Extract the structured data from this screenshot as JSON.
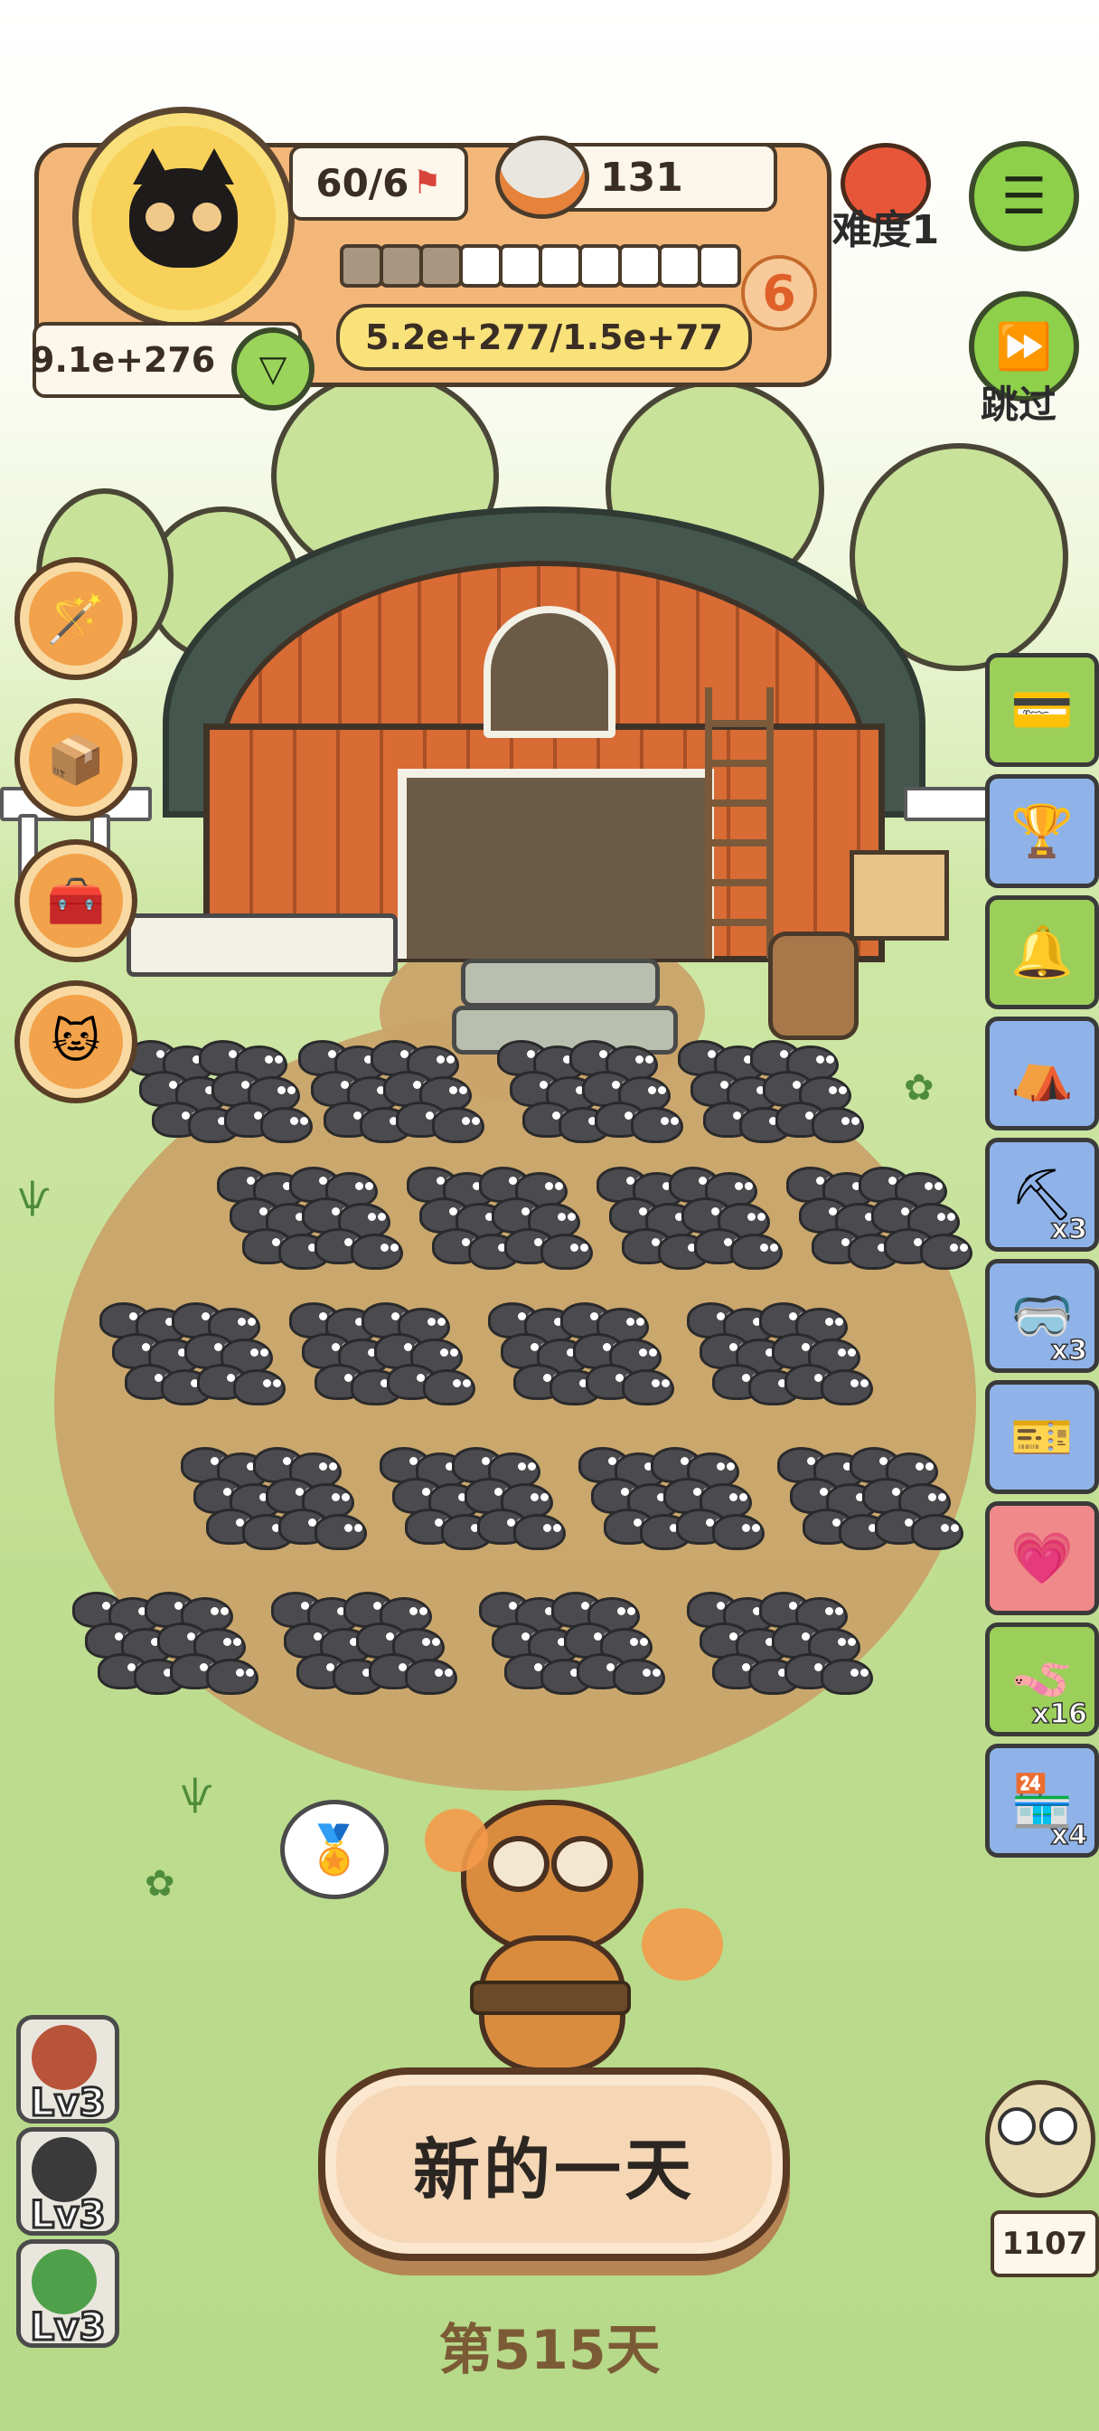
{
  "hud": {
    "moles_text": "60/6",
    "food_value": "131",
    "difficulty_label": "难度1",
    "level_number": "6",
    "progress_filled": 3,
    "progress_total": 10,
    "exp_text": "5.2e+277/1.5e+77",
    "money_value": "9.1e+276"
  },
  "right_buttons": {
    "skip_label": "跳过"
  },
  "right_cards": [
    {
      "name": "card-item",
      "color": "#9ccf5a",
      "icon": "💳",
      "count": ""
    },
    {
      "name": "trophy-item",
      "color": "#8fb3e8",
      "icon": "🏆",
      "count": ""
    },
    {
      "name": "bell-item",
      "color": "#9ccf5a",
      "icon": "🔔",
      "count": ""
    },
    {
      "name": "hut-item",
      "color": "#8fb3e8",
      "icon": "⛺",
      "count": ""
    },
    {
      "name": "scythe-item",
      "color": "#8fb3e8",
      "icon": "⛏",
      "count": "x3"
    },
    {
      "name": "vr-item",
      "color": "#8fb3e8",
      "icon": "🥽",
      "count": "x3"
    },
    {
      "name": "ticket-item",
      "color": "#8fb3e8",
      "icon": "🎫",
      "count": ""
    },
    {
      "name": "heart-item",
      "color": "#f08a8a",
      "icon": "💗",
      "count": ""
    },
    {
      "name": "worm-item",
      "color": "#9ccf5a",
      "icon": "🪱",
      "count": "x16"
    },
    {
      "name": "shop-item",
      "color": "#8fb3e8",
      "icon": "🏪",
      "count": "x4"
    }
  ],
  "left_tools": [
    {
      "name": "wand-tool",
      "icon": "🪄"
    },
    {
      "name": "box-tool",
      "icon": "📦"
    },
    {
      "name": "medkit-tool",
      "icon": "🧰"
    },
    {
      "name": "lucky-cat-tool",
      "icon": "🐱"
    }
  ],
  "level_cards": [
    {
      "label": "Lv3",
      "color": "#b7543a"
    },
    {
      "label": "Lv3",
      "color": "#3a3a3a"
    },
    {
      "label": "Lv3",
      "color": "#4fa04a"
    }
  ],
  "owl_count": "1107",
  "main_button_label": "新的一天",
  "day_label": "第515天"
}
